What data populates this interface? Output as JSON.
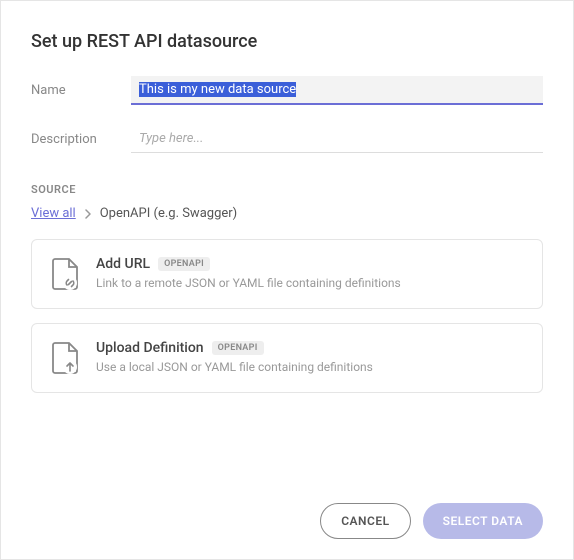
{
  "title": "Set up REST API datasource",
  "form": {
    "name_label": "Name",
    "name_value": "This is my new data source",
    "desc_label": "Description",
    "desc_placeholder": "Type here..."
  },
  "source": {
    "section_label": "SOURCE",
    "breadcrumb_link": "View all",
    "breadcrumb_current": "OpenAPI (e.g. Swagger)"
  },
  "options": [
    {
      "title": "Add URL",
      "tag": "OPENAPI",
      "desc": "Link to a remote JSON or YAML file containing definitions"
    },
    {
      "title": "Upload Definition",
      "tag": "OPENAPI",
      "desc": "Use a local JSON or YAML file containing definitions"
    }
  ],
  "footer": {
    "cancel": "CANCEL",
    "select": "SELECT DATA"
  }
}
